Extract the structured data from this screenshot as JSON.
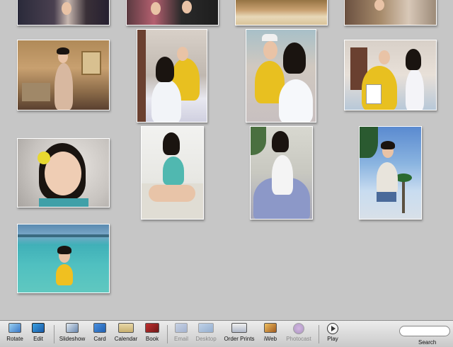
{
  "toolbar": {
    "rotate": "Rotate",
    "edit": "Edit",
    "slideshow": "Slideshow",
    "card": "Card",
    "calendar": "Calendar",
    "book": "Book",
    "email": "Email",
    "desktop": "Desktop",
    "order_prints": "Order Prints",
    "iweb": "iWeb",
    "photocast": "Photocast",
    "play": "Play",
    "search": "Search"
  },
  "colors": {
    "grid_background": "#c6c6c6",
    "toolbar_top": "#ececec",
    "toolbar_bottom": "#c9c9c9",
    "disabled_label": "#8a8a8a"
  },
  "photos": [
    {
      "id": "row1-a",
      "scene": "couple-dark"
    },
    {
      "id": "row1-b",
      "scene": "couple-pink"
    },
    {
      "id": "row1-c",
      "scene": "table-food"
    },
    {
      "id": "row1-d",
      "scene": "room-sitting"
    },
    {
      "id": "row2-a",
      "scene": "hotel-room-dress"
    },
    {
      "id": "row2-b",
      "scene": "bed-with-man-yellow"
    },
    {
      "id": "row2-c",
      "scene": "closeup-with-man-yellow"
    },
    {
      "id": "row2-d",
      "scene": "man-yellow-holding-cards"
    },
    {
      "id": "row3-a",
      "scene": "closeup-flower-hair"
    },
    {
      "id": "row3-b",
      "scene": "sitting-on-sofa-turquoise"
    },
    {
      "id": "row3-c",
      "scene": "bathtub-petals"
    },
    {
      "id": "row3-d",
      "scene": "palm-trees-sky"
    },
    {
      "id": "row4-a",
      "scene": "sea-yellow-top"
    }
  ]
}
